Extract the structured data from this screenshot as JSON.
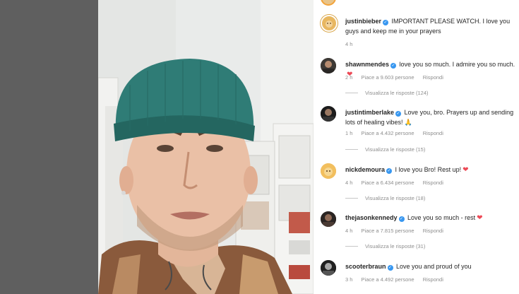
{
  "caption": {
    "username": "justinbieber",
    "text": "IMPORTANT PLEASE WATCH. I love you guys and keep me in your prayers",
    "time": "4 h"
  },
  "comments": [
    {
      "username": "shawnmendes",
      "text": "love you so much. I admire you so much.",
      "emoji": "heart",
      "time": "2 h",
      "likes": "Piace a 9.603 persone",
      "reply": "Rispondi",
      "view_replies": "Visualizza le risposte (124)"
    },
    {
      "username": "justintimberlake",
      "text": "Love you, bro. Prayers up and sending lots of healing vibes!",
      "emoji": "praying-hands",
      "time": "1 h",
      "likes": "Piace a 4.432 persone",
      "reply": "Rispondi",
      "view_replies": "Visualizza le risposte (15)"
    },
    {
      "username": "nickdemoura",
      "text": "I love you Bro! Rest up!",
      "emoji": "heart",
      "time": "4 h",
      "likes": "Piace a 6.434 persone",
      "reply": "Rispondi",
      "view_replies": "Visualizza le risposte (18)"
    },
    {
      "username": "thejasonkennedy",
      "text": "Love you so much - rest",
      "emoji": "heart",
      "time": "4 h",
      "likes": "Piace a 7.815 persone",
      "reply": "Rispondi",
      "view_replies": "Visualizza le risposte (31)"
    },
    {
      "username": "scooterbraun",
      "text": "Love you and proud of you",
      "emoji": "",
      "time": "3 h",
      "likes": "Piace a 4.492 persone",
      "reply": "Rispondi",
      "view_replies": ""
    }
  ],
  "colors": {
    "verified": "#3897f0",
    "heart": "#ed4956",
    "meta_text": "#8e8e8e",
    "gutter": "#5f5f5f"
  }
}
